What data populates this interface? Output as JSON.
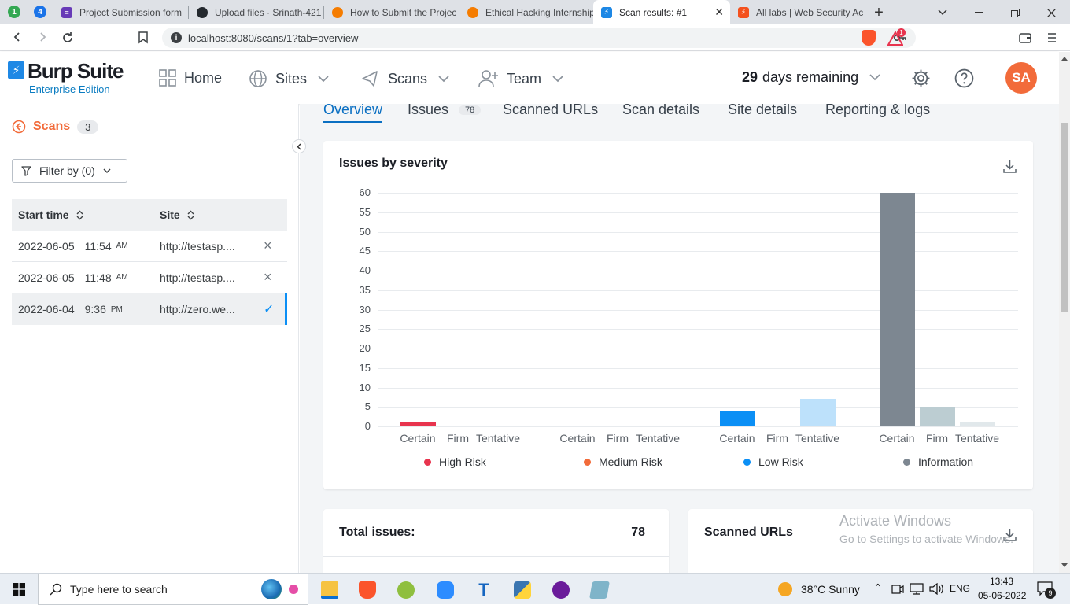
{
  "browser": {
    "tabs": [
      {
        "label": "Project Submission form",
        "color": "#673ab7"
      },
      {
        "label": "Upload files · Srinath-421",
        "color": "#24292e"
      },
      {
        "label": "How to Submit the Projec",
        "color": "#f57c00"
      },
      {
        "label": "Ethical Hacking Internship",
        "color": "#f57c00"
      },
      {
        "label": "Scan results: #1",
        "color": "#1e88e5"
      },
      {
        "label": "All labs | Web Security Ac",
        "color": "#f4511e"
      }
    ],
    "badges": [
      "1",
      "4"
    ],
    "url": "localhost:8080/scans/1?tab=overview",
    "ext_badge": "1"
  },
  "app": {
    "logo_title": "Burp Suite",
    "logo_subtitle": "Enterprise Edition",
    "nav": {
      "home": "Home",
      "sites": "Sites",
      "scans": "Scans",
      "team": "Team"
    },
    "days_remaining_num": "29",
    "days_remaining_text": "days remaining",
    "avatar": "SA"
  },
  "sidebar": {
    "title": "Scans",
    "count": "3",
    "filter": "Filter by (0)",
    "columns": {
      "start": "Start time",
      "site": "Site"
    },
    "rows": [
      {
        "date": "2022-06-05",
        "time": "11:54",
        "ampm": "AM",
        "site": "http://testasp....",
        "status": "×"
      },
      {
        "date": "2022-06-05",
        "time": "11:48",
        "ampm": "AM",
        "site": "http://testasp....",
        "status": "×"
      },
      {
        "date": "2022-06-04",
        "time": "9:36",
        "ampm": "PM",
        "site": "http://zero.we...",
        "status": "✓"
      }
    ]
  },
  "tabs": {
    "overview": "Overview",
    "issues": "Issues",
    "issues_count": "78",
    "scanned_urls": "Scanned URLs",
    "scan_details": "Scan details",
    "site_details": "Site details",
    "reporting": "Reporting & logs"
  },
  "chart_title": "Issues by severity",
  "chart_data": {
    "type": "bar",
    "title": "Issues by severity",
    "ylim": [
      0,
      60
    ],
    "yticks": [
      60,
      55,
      50,
      45,
      40,
      35,
      30,
      25,
      20,
      15,
      10,
      5,
      0
    ],
    "confidence_labels": [
      "Certain",
      "Firm",
      "Tentative"
    ],
    "groups": [
      {
        "name": "High Risk",
        "color": "#e8344e",
        "light": "#f7b8c2",
        "values": [
          1,
          0,
          0
        ]
      },
      {
        "name": "Medium Risk",
        "color": "#f26b3a",
        "light": "#f9c3ad",
        "values": [
          0,
          0,
          0
        ]
      },
      {
        "name": "Low Risk",
        "color": "#0b8ff5",
        "light": "#bde1fb",
        "values": [
          4,
          0,
          7
        ]
      },
      {
        "name": "Information",
        "color": "#7d8791",
        "light": "#bccdd2",
        "values": [
          60,
          5,
          1
        ]
      }
    ]
  },
  "bottom": {
    "total_label": "Total issues:",
    "total_value": "78",
    "scanned_label": "Scanned URLs",
    "watermark1": "Activate Windows",
    "watermark2": "Go to Settings to activate Windows."
  },
  "taskbar": {
    "search": "Type here to search",
    "weather": "38°C  Sunny",
    "lang": "ENG",
    "time": "13:43",
    "date": "05-06-2022",
    "notif": "9"
  }
}
